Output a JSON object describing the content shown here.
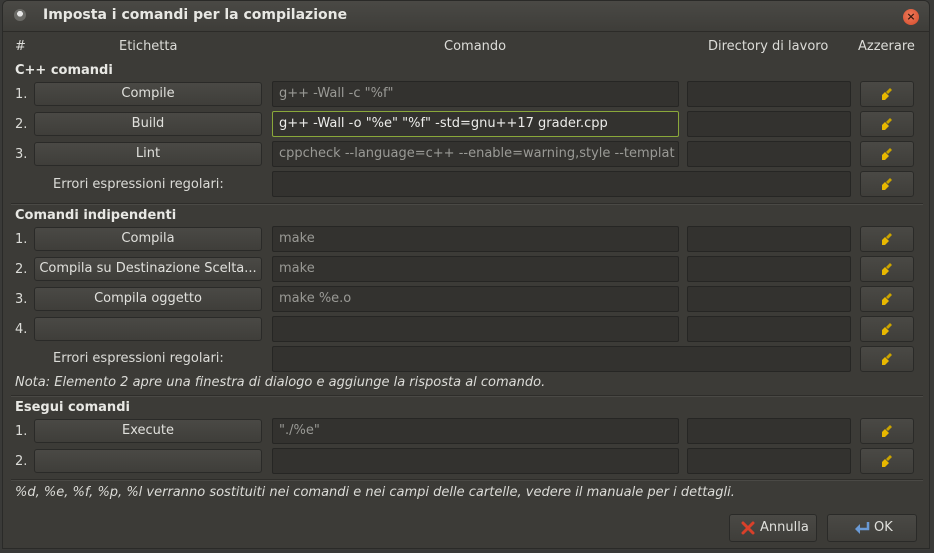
{
  "window": {
    "title": "Imposta i comandi per la compilazione"
  },
  "headers": {
    "num": "#",
    "label": "Etichetta",
    "command": "Comando",
    "workdir": "Directory di lavoro",
    "reset": "Azzerare"
  },
  "sections": {
    "cpp": {
      "title": "C++ comandi",
      "rows": [
        {
          "num": "1.",
          "label": "Compile",
          "command": "g++ -Wall -c \"%f\"",
          "workdir": ""
        },
        {
          "num": "2.",
          "label": "Build",
          "command": "g++ -Wall -o \"%e\" \"%f\" -std=gnu++17 grader.cpp",
          "workdir": ""
        },
        {
          "num": "3.",
          "label": "Lint",
          "command": "cppcheck --language=c++ --enable=warning,style --templat",
          "workdir": ""
        }
      ],
      "regex_label": "Errori espressioni regolari:",
      "regex_value": ""
    },
    "independent": {
      "title": "Comandi indipendenti",
      "rows": [
        {
          "num": "1.",
          "label": "Compila",
          "command": "make",
          "workdir": ""
        },
        {
          "num": "2.",
          "label": "Compila su Destinazione Scelta...",
          "command": "make",
          "workdir": ""
        },
        {
          "num": "3.",
          "label": "Compila oggetto",
          "command": "make %e.o",
          "workdir": ""
        },
        {
          "num": "4.",
          "label": "",
          "command": "",
          "workdir": ""
        }
      ],
      "regex_label": "Errori espressioni regolari:",
      "regex_value": "",
      "note": "Nota: Elemento 2 apre una finestra di dialogo e aggiunge la risposta al comando."
    },
    "execute": {
      "title": "Esegui comandi",
      "rows": [
        {
          "num": "1.",
          "label": "Execute",
          "command": "\"./%e\"",
          "workdir": ""
        },
        {
          "num": "2.",
          "label": "",
          "command": "",
          "workdir": ""
        }
      ]
    }
  },
  "footer": {
    "hint": "%d, %e, %f, %p, %l verranno sostituiti nei comandi e nei campi delle cartelle, vedere il manuale per i dettagli.",
    "cancel_label": "Annulla",
    "ok_label": "OK"
  },
  "colors": {
    "accent_border": "#8aa83a",
    "broom_icon": "#e8b800",
    "cancel_icon": "#d9402a",
    "ok_icon": "#6a9ad6"
  }
}
